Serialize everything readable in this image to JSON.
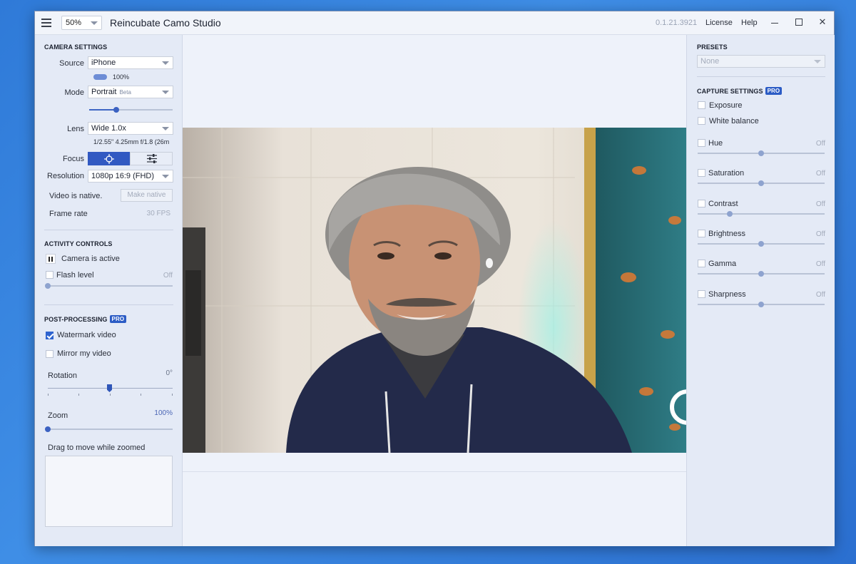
{
  "titlebar": {
    "zoom_value": "50%",
    "app_title": "Reincubate Camo Studio",
    "version": "0.1.21.3921",
    "license_label": "License",
    "help_label": "Help",
    "close_glyph": "✕"
  },
  "camera_settings": {
    "title": "CAMERA SETTINGS",
    "source_label": "Source",
    "source_value": "iPhone",
    "battery_text": "100%",
    "mode_label": "Mode",
    "mode_value": "Portrait",
    "mode_badge": "Beta",
    "mode_slider_level": 0.33,
    "lens_label": "Lens",
    "lens_value": "Wide 1.0x",
    "lens_info": "1/2.55\" 4.25mm f/1.8 (26m",
    "focus_label": "Focus",
    "resolution_label": "Resolution",
    "resolution_value": "1080p 16:9 (FHD)",
    "video_native_text": "Video is native.",
    "make_native_label": "Make native",
    "frame_rate_label": "Frame rate",
    "frame_rate_value": "30 FPS"
  },
  "activity_controls": {
    "title": "ACTIVITY CONTROLS",
    "camera_active_label": "Camera is active",
    "flash_label": "Flash level",
    "flash_value": "Off"
  },
  "post_processing": {
    "title": "POST-PROCESSING",
    "pro_badge": "PRO",
    "watermark_label": "Watermark video",
    "watermark_checked": true,
    "mirror_label": "Mirror my video",
    "mirror_checked": false,
    "rotation_label": "Rotation",
    "rotation_value": "0°",
    "zoom_label": "Zoom",
    "zoom_value": "100%",
    "drag_label": "Drag to move while zoomed"
  },
  "presets": {
    "title": "PRESETS",
    "value": "None"
  },
  "capture_settings": {
    "title": "CAPTURE SETTINGS",
    "pro_badge": "PRO",
    "exposure_label": "Exposure",
    "white_balance_label": "White balance",
    "sliders": [
      {
        "label": "Hue",
        "value": "Off",
        "level": 0.5
      },
      {
        "label": "Saturation",
        "value": "Off",
        "level": 0.5
      },
      {
        "label": "Contrast",
        "value": "Off",
        "level": 0.25
      },
      {
        "label": "Brightness",
        "value": "Off",
        "level": 0.5
      },
      {
        "label": "Gamma",
        "value": "Off",
        "level": 0.5
      },
      {
        "label": "Sharpness",
        "value": "Off",
        "level": 0.5
      }
    ]
  },
  "colors": {
    "accent": "#3159c2",
    "panel_bg": "#e4eaf6",
    "window_bg": "#eef2fa",
    "desktop": "#2f7ad8"
  }
}
